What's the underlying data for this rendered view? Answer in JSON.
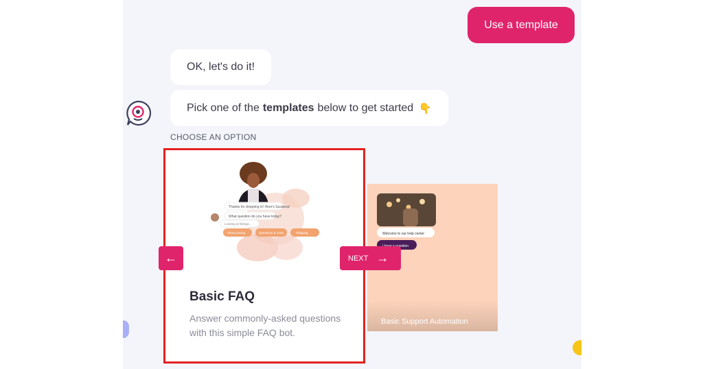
{
  "user_message": "Use a template",
  "bot_messages": {
    "first": "OK, let's do it!",
    "second_before": "Pick one of the",
    "second_bold": "templates",
    "second_after": "below to get started",
    "second_emoji": "👇"
  },
  "choose_label": "CHOOSE AN OPTION",
  "carousel": {
    "prev_icon": "arrow-left-icon",
    "next_label": "NEXT",
    "next_icon": "arrow-right-icon",
    "cards": [
      {
        "title": "Basic FAQ",
        "description": "Answer commonly-asked questions with this simple FAQ bot.",
        "preview": {
          "chat_line_1": "Thanks for dropping in! Here's Susanna!",
          "chat_line_2": "What question do you have today?",
          "chat_line_3": "Looking at listings...",
          "buttons": [
            "About joining",
            "Questions & more",
            "Shipping"
          ]
        }
      },
      {
        "title": "Basic Support Automation",
        "preview": {
          "chat_line": "Welcome to our help center",
          "button": "I have a question"
        }
      }
    ]
  },
  "colors": {
    "accent": "#e0246c",
    "highlight_border": "#e32020",
    "chat_background": "#f4f5fb",
    "second_card": "#fdd3bb"
  },
  "icons": {
    "bot_avatar": "chat-bot-avatar-icon"
  }
}
